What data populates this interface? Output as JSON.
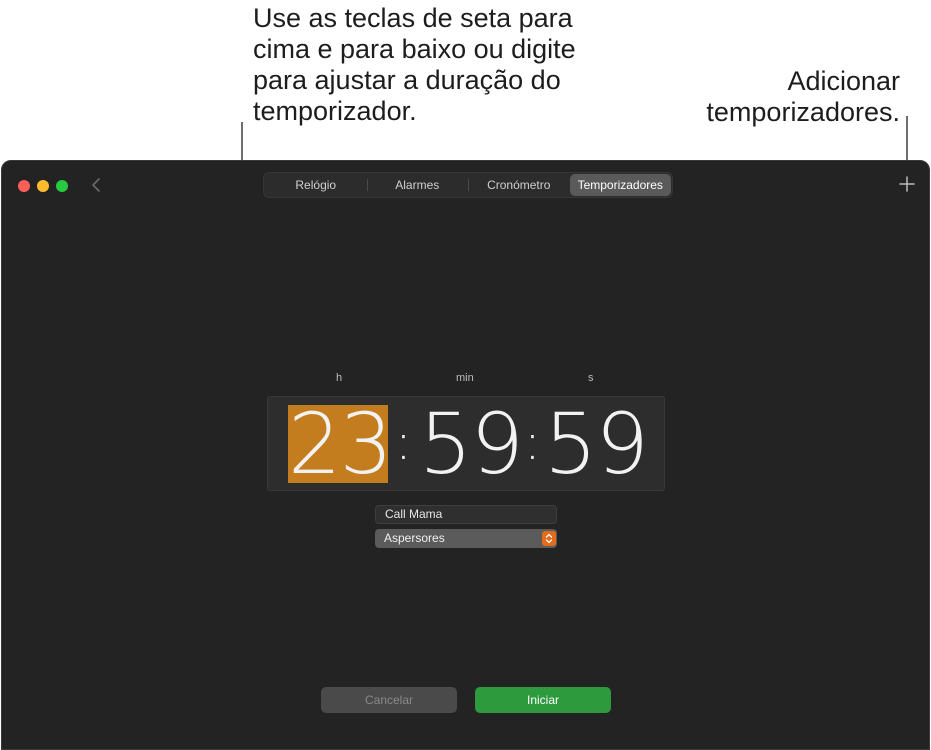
{
  "callouts": {
    "duration_hint": "Use as teclas de seta para\ncima e para baixo ou digite\npara ajustar a duração do\ntemporizador.",
    "add_timers": "Adicionar\ntemporizadores."
  },
  "tabs": [
    {
      "label": "Relógio"
    },
    {
      "label": "Alarmes"
    },
    {
      "label": "Cronómetro"
    },
    {
      "label": "Temporizadores",
      "active": true
    }
  ],
  "timer": {
    "unit_labels": {
      "hours": "h",
      "minutes": "min",
      "seconds": "s"
    },
    "hours": "23",
    "minutes": "59",
    "seconds": "59",
    "separator": ":",
    "label_value": "Call Mama",
    "sound": "Aspersores"
  },
  "buttons": {
    "cancel": "Cancelar",
    "start": "Iniciar"
  },
  "colors": {
    "accent_hours": "#c47d1e",
    "start_button": "#2d9a3e",
    "popup_chevron": "#e26b1c"
  },
  "icons": [
    "back-chevron-icon",
    "plus-icon"
  ]
}
